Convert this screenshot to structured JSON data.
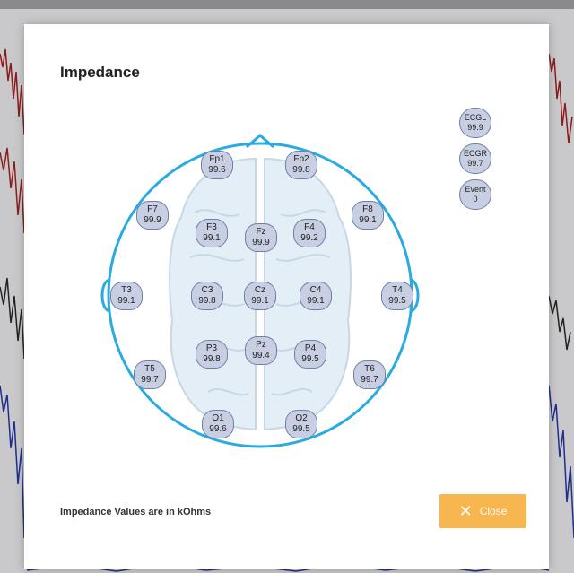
{
  "dialog": {
    "title": "Impedance",
    "footnote": "Impedance Values are in kOhms",
    "close_label": "Close"
  },
  "electrodes": {
    "Fp1": {
      "label": "Fp1",
      "value": "99.6"
    },
    "Fp2": {
      "label": "Fp2",
      "value": "99.8"
    },
    "F7": {
      "label": "F7",
      "value": "99.9"
    },
    "F8": {
      "label": "F8",
      "value": "99.1"
    },
    "F3": {
      "label": "F3",
      "value": "99.1"
    },
    "Fz": {
      "label": "Fz",
      "value": "99.9"
    },
    "F4": {
      "label": "F4",
      "value": "99.2"
    },
    "T3": {
      "label": "T3",
      "value": "99.1"
    },
    "C3": {
      "label": "C3",
      "value": "99.8"
    },
    "Cz": {
      "label": "Cz",
      "value": "99.1"
    },
    "C4": {
      "label": "C4",
      "value": "99.1"
    },
    "T4": {
      "label": "T4",
      "value": "99.5"
    },
    "P3": {
      "label": "P3",
      "value": "99.8"
    },
    "Pz": {
      "label": "Pz",
      "value": "99.4"
    },
    "P4": {
      "label": "P4",
      "value": "99.5"
    },
    "T5": {
      "label": "T5",
      "value": "99.7"
    },
    "T6": {
      "label": "T6",
      "value": "99.7"
    },
    "O1": {
      "label": "O1",
      "value": "99.6"
    },
    "O2": {
      "label": "O2",
      "value": "99.5"
    }
  },
  "aux_channels": {
    "ECGL": {
      "label": "ECGL",
      "value": "99.9"
    },
    "ECGR": {
      "label": "ECGR",
      "value": "99.7"
    },
    "Event": {
      "label": "Event",
      "value": "0"
    }
  },
  "colors": {
    "head_outline": "#29abe2",
    "close_button": "#f7b650",
    "electrode_fill": "#c8cfe3"
  }
}
